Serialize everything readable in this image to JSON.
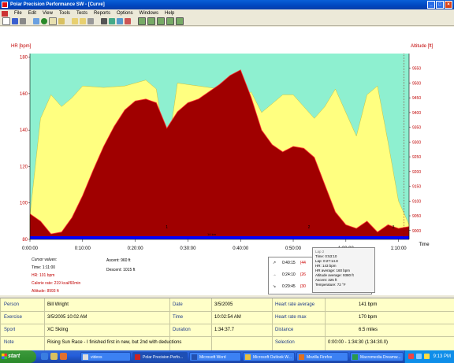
{
  "window": {
    "title": "Polar Precision Performance SW - [Curve]",
    "buttons": {
      "minimize": "_",
      "maximize": "□",
      "close": "×"
    }
  },
  "menu": [
    "File",
    "Edit",
    "View",
    "Tools",
    "Tests",
    "Reports",
    "Options",
    "Windows",
    "Help"
  ],
  "toolbar_icons": [
    "new-icon",
    "save-icon",
    "print-icon",
    "copy-icon",
    "globe-icon",
    "open-icon",
    "folder-icon",
    "calendar-icon",
    "zoom-icon",
    "chart-icon",
    "bar-chart-icon",
    "line-chart-icon",
    "stat-icon",
    "sum-icon",
    "compare-icon"
  ],
  "chart": {
    "hr_axis_label": "HR [bpm]",
    "alt_axis_label": "Altitude [ft]",
    "time_label": "Time",
    "hr_ticks": [
      "180",
      "160",
      "140",
      "120",
      "100",
      "80"
    ],
    "alt_ticks": [
      "9550",
      "9500",
      "9450",
      "9400",
      "9350",
      "9300",
      "9250",
      "9200",
      "9150",
      "9100",
      "9050",
      "9000"
    ],
    "time_ticks": [
      "0:00:00",
      "0:10:00",
      "0:20:00",
      "0:30:00",
      "0:40:00",
      "0:50:00",
      "1:00:00",
      "1:10:00"
    ],
    "lap_markers": [
      "1",
      "2",
      "3"
    ],
    "track_label": "14 km",
    "colors": {
      "background": "#8ef0d0",
      "altitude": "#ffff80",
      "hr": "#a00000",
      "hr_line": "#ff3030",
      "track": "#0000ff"
    }
  },
  "chart_data": {
    "type": "area",
    "x_unit": "h:mm:ss",
    "xlim": [
      "0:00:00",
      "1:34:37"
    ],
    "series": [
      {
        "name": "Altitude",
        "unit": "ft",
        "ylim": [
          8970,
          9600
        ],
        "x": [
          "0:00:00",
          "0:02:00",
          "0:04:00",
          "0:06:00",
          "0:08:00",
          "0:10:00",
          "0:14:00",
          "0:18:00",
          "0:20:00",
          "0:22:00",
          "0:24:00",
          "0:26:00",
          "0:28:00",
          "0:32:00",
          "0:36:00",
          "0:38:00",
          "0:40:00",
          "0:42:00",
          "0:44:00",
          "0:46:00",
          "0:48:00",
          "0:50:00",
          "0:52:00",
          "0:54:00",
          "0:56:00",
          "0:58:00",
          "1:00:00",
          "1:02:00",
          "1:04:00",
          "1:06:00",
          "1:08:00",
          "1:10:00",
          "1:12:00"
        ],
        "values": [
          9050,
          9380,
          9460,
          9420,
          9450,
          9490,
          9485,
          9490,
          9500,
          9510,
          9480,
          9250,
          9500,
          9490,
          9480,
          9460,
          9450,
          9470,
          9400,
          9430,
          9460,
          9460,
          9420,
          9380,
          9420,
          9480,
          9400,
          9320,
          9460,
          9490,
          9300,
          9100,
          9020
        ]
      },
      {
        "name": "HR",
        "unit": "bpm",
        "ylim": [
          80,
          182
        ],
        "x": [
          "0:00:00",
          "0:02:00",
          "0:04:00",
          "0:06:00",
          "0:08:00",
          "0:10:00",
          "0:12:00",
          "0:14:00",
          "0:16:00",
          "0:18:00",
          "0:20:00",
          "0:22:00",
          "0:24:00",
          "0:26:00",
          "0:28:00",
          "0:30:00",
          "0:32:00",
          "0:34:00",
          "0:36:00",
          "0:38:00",
          "0:40:00",
          "0:42:00",
          "0:44:00",
          "0:46:00",
          "0:48:00",
          "0:50:00",
          "0:52:00",
          "0:54:00",
          "0:56:00",
          "0:58:00",
          "1:00:00",
          "1:02:00",
          "1:04:00",
          "1:06:00",
          "1:08:00",
          "1:10:00",
          "1:12:00"
        ],
        "values": [
          94,
          90,
          83,
          84,
          92,
          104,
          118,
          131,
          142,
          151,
          156,
          157,
          155,
          141,
          150,
          155,
          157,
          161,
          165,
          170,
          173,
          158,
          140,
          132,
          128,
          131,
          130,
          125,
          110,
          95,
          88,
          86,
          90,
          84,
          88,
          86,
          87
        ]
      }
    ]
  },
  "cursor": {
    "title": "Cursor values:",
    "time": "Time: 1:11:00",
    "hr": "HR: 101 bpm",
    "calorie": "Calorie rate: 219 kcal/60min",
    "altitude": "Altitude: 8993 ft",
    "ascent": "Ascent: 960 ft",
    "descent": "Descent: 1015 ft"
  },
  "laps_table": [
    {
      "sym": "↗",
      "time": "0:40:15",
      "val": "(44"
    },
    {
      "sym": "→",
      "time": "0:24:10",
      "val": "(26"
    },
    {
      "sym": "↘",
      "time": "0:29:45",
      "val": "(30"
    }
  ],
  "tooltip": {
    "title": "Lap 2",
    "lines": [
      "Time: 0:53:10",
      "Lap: 0:27:14.8",
      "HR: 143 bpm",
      "HR average: 160 bpm",
      "Altitude average: 9380 ft",
      "Ascent: 325 ft",
      "Temperature: 72 °F"
    ]
  },
  "summary": {
    "person_label": "Person",
    "person": "Bill Wright",
    "exercise_label": "Exercise",
    "exercise": "3/5/2005 10:02 AM",
    "sport_label": "Sport",
    "sport": "XC Skiing",
    "note_label": "Note",
    "note": "Rising Sun Race - I finished first in new, but 2nd with deductions",
    "date_label": "Date",
    "date": "3/5/2005",
    "time_label": "Time",
    "time": "10:02:54 AM",
    "duration_label": "Duration",
    "duration": "1:34:37.7",
    "hr_avg_label": "Heart rate average",
    "hr_avg": "141 bpm",
    "hr_max_label": "Heart rate max",
    "hr_max": "170 bpm",
    "distance_label": "Distance",
    "distance": "6.5 miles",
    "selection_label": "Selection",
    "selection": "0:00:00 - 1:34:30 (1:34:30.0)"
  },
  "taskbar": {
    "start": "start",
    "tasks": [
      "videos",
      "Polar Precision Perfo...",
      "Microsoft Word",
      "Microsoft Outlook W...",
      "Mozilla Firefox",
      "Macromedia Dreamw..."
    ],
    "clock": "9:13 PM"
  }
}
